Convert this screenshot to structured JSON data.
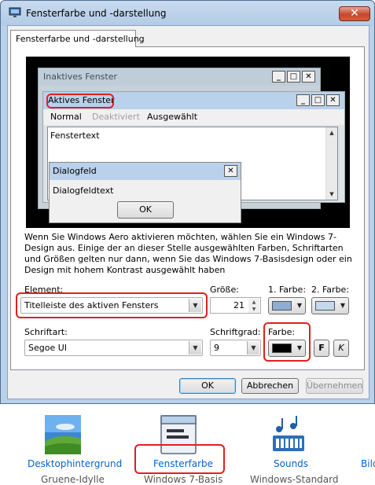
{
  "window": {
    "title": "Fensterfarbe und -darstellung",
    "close_glyph": "✕"
  },
  "tab": {
    "label": "Fensterfarbe und -darstellung"
  },
  "preview": {
    "inactive_title": "Inaktives Fenster",
    "active_title": "Aktives Fenster",
    "menu": {
      "normal": "Normal",
      "disabled": "Deaktiviert",
      "selected": "Ausgewählt"
    },
    "window_text": "Fenstertext",
    "dialog_title": "Dialogfeld",
    "dialog_text": "Dialogfeldtext",
    "dialog_ok": "OK",
    "caption_buttons": [
      "_",
      "□",
      "✕"
    ]
  },
  "info_text": "Wenn Sie Windows Aero aktivieren möchten, wählen Sie ein Windows 7-Design aus. Einige der an dieser Stelle ausgewählten Farben, Schriftarten und Größen gelten nur dann, wenn Sie das Windows 7-Basisdesign oder ein Design mit hohem Kontrast ausgewählt haben",
  "element": {
    "label": "Element:",
    "value": "Titelleiste des aktiven Fensters"
  },
  "size": {
    "label": "Größe:",
    "value": "21"
  },
  "color1": {
    "label": "1. Farbe:",
    "swatch": "#8eadd4"
  },
  "color2": {
    "label": "2. Farbe:",
    "swatch": "#c4d9ef"
  },
  "font": {
    "label": "Schriftart:",
    "value": "Segoe UI"
  },
  "font_size": {
    "label": "Schriftgrad:",
    "value": "9"
  },
  "font_color": {
    "label": "Farbe:",
    "swatch": "#000000"
  },
  "bold_label": "F",
  "italic_label": "K",
  "buttons": {
    "ok": "OK",
    "cancel": "Abbrechen",
    "apply": "Übernehmen"
  },
  "personalization": [
    {
      "label": "Desktophintergrund",
      "sub": "Gruene-Idylle",
      "icon": "landscape-icon"
    },
    {
      "label": "Fensterfarbe",
      "sub": "Windows 7-Basis",
      "icon": "window-color-icon"
    },
    {
      "label": "Sounds",
      "sub": "Windows-Standard",
      "icon": "music-notes-icon"
    },
    {
      "label": "Bild",
      "sub": "",
      "icon": ""
    }
  ],
  "colors": {
    "highlight_red": "#e02020",
    "link_blue": "#0066cc"
  }
}
